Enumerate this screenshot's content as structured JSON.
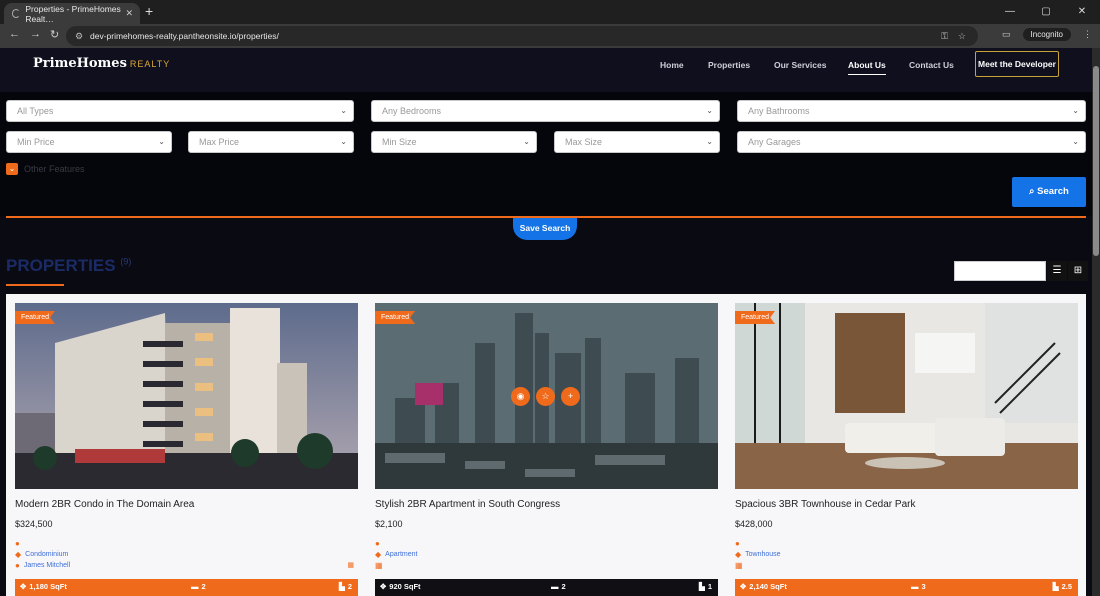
{
  "browser": {
    "tab_title": "Properties - PrimeHomes Realt…",
    "new_tab": "+",
    "url": "dev-primehomes-realty.pantheonsite.io/properties/",
    "incognito_label": "Incognito"
  },
  "header": {
    "logo_main": "PrimeHomes",
    "logo_sub": "REALTY",
    "nav": [
      "Home",
      "Properties",
      "Our Services",
      "About Us",
      "Contact Us"
    ],
    "developer_button": "Meet the Developer"
  },
  "filters": {
    "type": "All Types",
    "bedrooms": "Any Bedrooms",
    "bathrooms": "Any Bathrooms",
    "min_price": "Min Price",
    "max_price": "Max Price",
    "min_size": "Min Size",
    "max_size": "Max Size",
    "garages": "Any Garages",
    "other_features": "Other Features",
    "search_label": "Search",
    "save_search_label": "Save Search"
  },
  "listing": {
    "title": "PROPERTIES",
    "count": "(9)"
  },
  "cards": [
    {
      "badge": "Featured",
      "title": "Modern 2BR Condo in The Domain Area",
      "price": "$324,500",
      "type": "Condominium",
      "agent": "James Mitchell",
      "sqft": "1,180 SqFt",
      "beds": "2",
      "baths": "2"
    },
    {
      "badge": "Featured",
      "title": "Stylish 2BR Apartment in South Congress",
      "price": "$2,100",
      "type": "Apartment",
      "sqft": "920 SqFt",
      "beds": "2",
      "baths": "1"
    },
    {
      "badge": "Featured",
      "title": "Spacious 3BR Townhouse in Cedar Park",
      "price": "$428,000",
      "type": "Townhouse",
      "sqft": "2,140 SqFt",
      "beds": "3",
      "baths": "2.5"
    }
  ],
  "colors": {
    "accent": "#f06a1c",
    "primary_blue": "#1473e6",
    "header_bg": "#0f0f1e",
    "gold": "#c9a23a"
  }
}
